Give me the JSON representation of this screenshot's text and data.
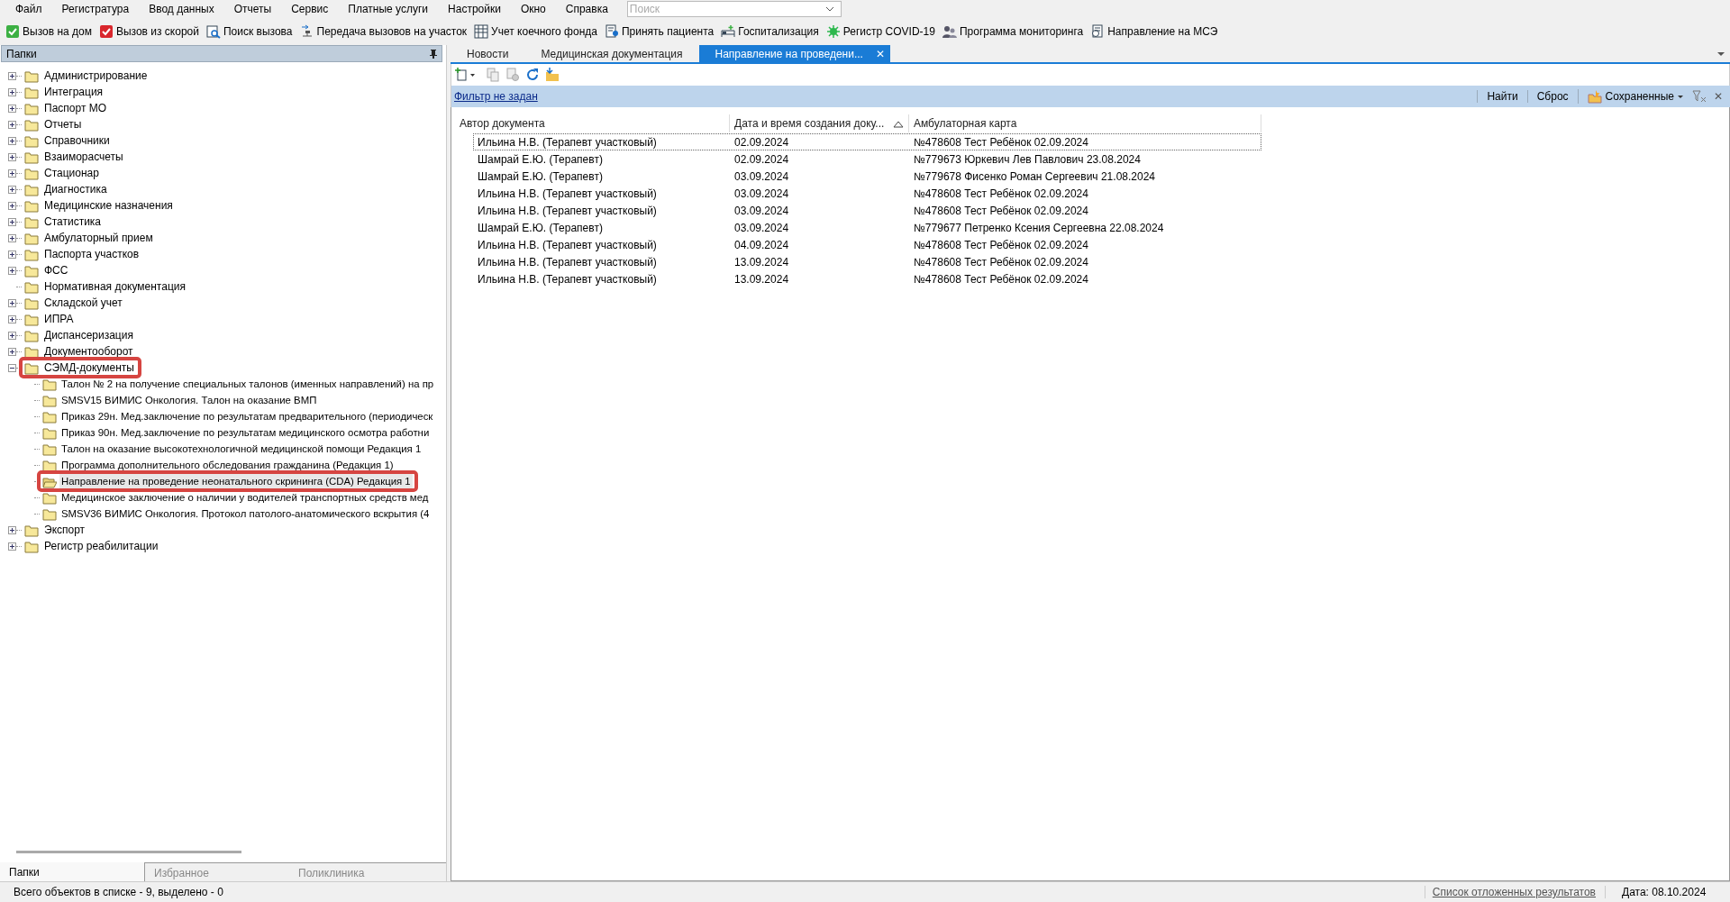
{
  "menu": [
    "Файл",
    "Регистратура",
    "Ввод данных",
    "Отчеты",
    "Сервис",
    "Платные услуги",
    "Настройки",
    "Окно",
    "Справка"
  ],
  "search": {
    "placeholder": "Поиск"
  },
  "toolbar": [
    "Вызов на дом",
    "Вызов из скорой",
    "Поиск вызова",
    "Передача вызовов на участок",
    "Учет коечного фонда",
    "Принять пациента",
    "Госпитализация",
    "Регистр COVID-19",
    "Программа мониторинга",
    "Направление на МСЭ"
  ],
  "sidebar": {
    "title": "Папки",
    "items": [
      {
        "label": "Администрирование",
        "expandable": true,
        "expanded": false,
        "highlighted": false,
        "selected": false
      },
      {
        "label": "Интеграция",
        "expandable": true,
        "expanded": false,
        "highlighted": false,
        "selected": false
      },
      {
        "label": "Паспорт МО",
        "expandable": true,
        "expanded": false,
        "highlighted": false,
        "selected": false
      },
      {
        "label": "Отчеты",
        "expandable": true,
        "expanded": false,
        "highlighted": false,
        "selected": false
      },
      {
        "label": "Справочники",
        "expandable": true,
        "expanded": false,
        "highlighted": false,
        "selected": false
      },
      {
        "label": "Взаиморасчеты",
        "expandable": true,
        "expanded": false,
        "highlighted": false,
        "selected": false
      },
      {
        "label": "Стационар",
        "expandable": true,
        "expanded": false,
        "highlighted": false,
        "selected": false
      },
      {
        "label": "Диагностика",
        "expandable": true,
        "expanded": false,
        "highlighted": false,
        "selected": false
      },
      {
        "label": "Медицинские назначения",
        "expandable": true,
        "expanded": false,
        "highlighted": false,
        "selected": false
      },
      {
        "label": "Статистика",
        "expandable": true,
        "expanded": false,
        "highlighted": false,
        "selected": false
      },
      {
        "label": "Амбулаторный прием",
        "expandable": true,
        "expanded": false,
        "highlighted": false,
        "selected": false
      },
      {
        "label": "Паспорта участков",
        "expandable": true,
        "expanded": false,
        "highlighted": false,
        "selected": false
      },
      {
        "label": "ФСС",
        "expandable": true,
        "expanded": false,
        "highlighted": false,
        "selected": false
      },
      {
        "label": "Нормативная документация",
        "expandable": false,
        "highlighted": false,
        "selected": false
      },
      {
        "label": "Складской учет",
        "expandable": true,
        "expanded": false,
        "highlighted": false,
        "selected": false
      },
      {
        "label": "ИПРА",
        "expandable": true,
        "expanded": false,
        "highlighted": false,
        "selected": false
      },
      {
        "label": "Диспансеризация",
        "expandable": true,
        "expanded": false,
        "highlighted": false,
        "selected": false
      },
      {
        "label": "Документооборот",
        "expandable": true,
        "expanded": false,
        "highlighted": false,
        "selected": false
      },
      {
        "label": "СЭМД-документы",
        "expandable": true,
        "expanded": true,
        "highlighted": true,
        "selected": false,
        "children": [
          {
            "label": "Талон № 2 на получение специальных талонов (именных направлений) на пр",
            "expandable": false,
            "highlighted": false,
            "selected": false
          },
          {
            "label": "SMSV15 ВИМИС Онкология. Талон на оказание ВМП",
            "expandable": false,
            "highlighted": false,
            "selected": false
          },
          {
            "label": "Приказ 29н. Мед.заключение по результатам предварительного (периодическ",
            "expandable": false,
            "highlighted": false,
            "selected": false
          },
          {
            "label": "Приказ 90н. Мед.заключение по результатам медицинского осмотра работни",
            "expandable": false,
            "highlighted": false,
            "selected": false
          },
          {
            "label": "Талон на оказание высокотехнологичной медицинской помощи Редакция 1",
            "expandable": false,
            "highlighted": false,
            "selected": false
          },
          {
            "label": "Программа дополнительного обследования гражданина (Редакция 1)",
            "expandable": false,
            "highlighted": false,
            "selected": false
          },
          {
            "label": "Направление на проведение неонатального скрининга (CDA) Редакция 1",
            "expandable": false,
            "highlighted": true,
            "selected": true
          },
          {
            "label": "Медицинское заключение о наличии у водителей транспортных средств мед",
            "expandable": false,
            "highlighted": false,
            "selected": false
          },
          {
            "label": "SMSV36 ВИМИС Онкология. Протокол патолого-анатомического вскрытия (4",
            "expandable": false,
            "highlighted": false,
            "selected": false
          }
        ]
      },
      {
        "label": "Экспорт",
        "expandable": true,
        "expanded": false,
        "highlighted": false,
        "selected": false
      },
      {
        "label": "Регистр реабилитации",
        "expandable": true,
        "expanded": false,
        "highlighted": false,
        "selected": false
      }
    ],
    "tabs": [
      {
        "label": "Папки",
        "selected": true
      },
      {
        "label": "Избранное",
        "selected": false
      },
      {
        "label": "Поликлиника",
        "selected": false
      }
    ]
  },
  "doc_tabs": [
    {
      "label": "Новости",
      "selected": false,
      "closable": false
    },
    {
      "label": "Медицинская документация",
      "selected": false,
      "closable": false
    },
    {
      "label": "Направление на проведени...",
      "selected": true,
      "closable": true,
      "close": "✕"
    }
  ],
  "filter": {
    "link": "Фильтр не задан",
    "buttons": [
      "Найти",
      "Сброс",
      "Сохраненные"
    ],
    "close": "✕"
  },
  "table": {
    "columns": [
      {
        "label": "Автор документа",
        "sorted": false
      },
      {
        "label": "Дата и время создания доку...",
        "sorted": true
      },
      {
        "label": "Амбулаторная карта",
        "sorted": false
      }
    ],
    "rows": [
      {
        "cells": [
          "Ильина Н.В. (Терапевт участковый)",
          "02.09.2024",
          "№478608 Тест Ребёнок  02.09.2024"
        ],
        "selected": true
      },
      {
        "cells": [
          "Шамрай Е.Ю. (Терапевт)",
          "02.09.2024",
          "№779673 Юркевич Лев Павлович 23.08.2024"
        ],
        "selected": false
      },
      {
        "cells": [
          "Шамрай Е.Ю. (Терапевт)",
          "03.09.2024",
          "№779678 Фисенко Роман Сергеевич 21.08.2024"
        ],
        "selected": false
      },
      {
        "cells": [
          "Ильина Н.В. (Терапевт участковый)",
          "03.09.2024",
          "№478608 Тест Ребёнок  02.09.2024"
        ],
        "selected": false
      },
      {
        "cells": [
          "Ильина Н.В. (Терапевт участковый)",
          "03.09.2024",
          "№478608 Тест Ребёнок  02.09.2024"
        ],
        "selected": false
      },
      {
        "cells": [
          "Шамрай Е.Ю. (Терапевт)",
          "03.09.2024",
          "№779677 Петренко Ксения Сергеевна 22.08.2024"
        ],
        "selected": false
      },
      {
        "cells": [
          "Ильина Н.В. (Терапевт участковый)",
          "04.09.2024",
          "№478608 Тест Ребёнок  02.09.2024"
        ],
        "selected": false
      },
      {
        "cells": [
          "Ильина Н.В. (Терапевт участковый)",
          "13.09.2024",
          "№478608 Тест Ребёнок  02.09.2024"
        ],
        "selected": false
      },
      {
        "cells": [
          "Ильина Н.В. (Терапевт участковый)",
          "13.09.2024",
          "№478608 Тест Ребёнок  02.09.2024"
        ],
        "selected": false
      }
    ]
  },
  "status_bar": {
    "count": "Всего объектов в списке - 9, выделено - 0",
    "link": "Список отложенных результатов",
    "date": "Дата: 08.10.2024"
  }
}
